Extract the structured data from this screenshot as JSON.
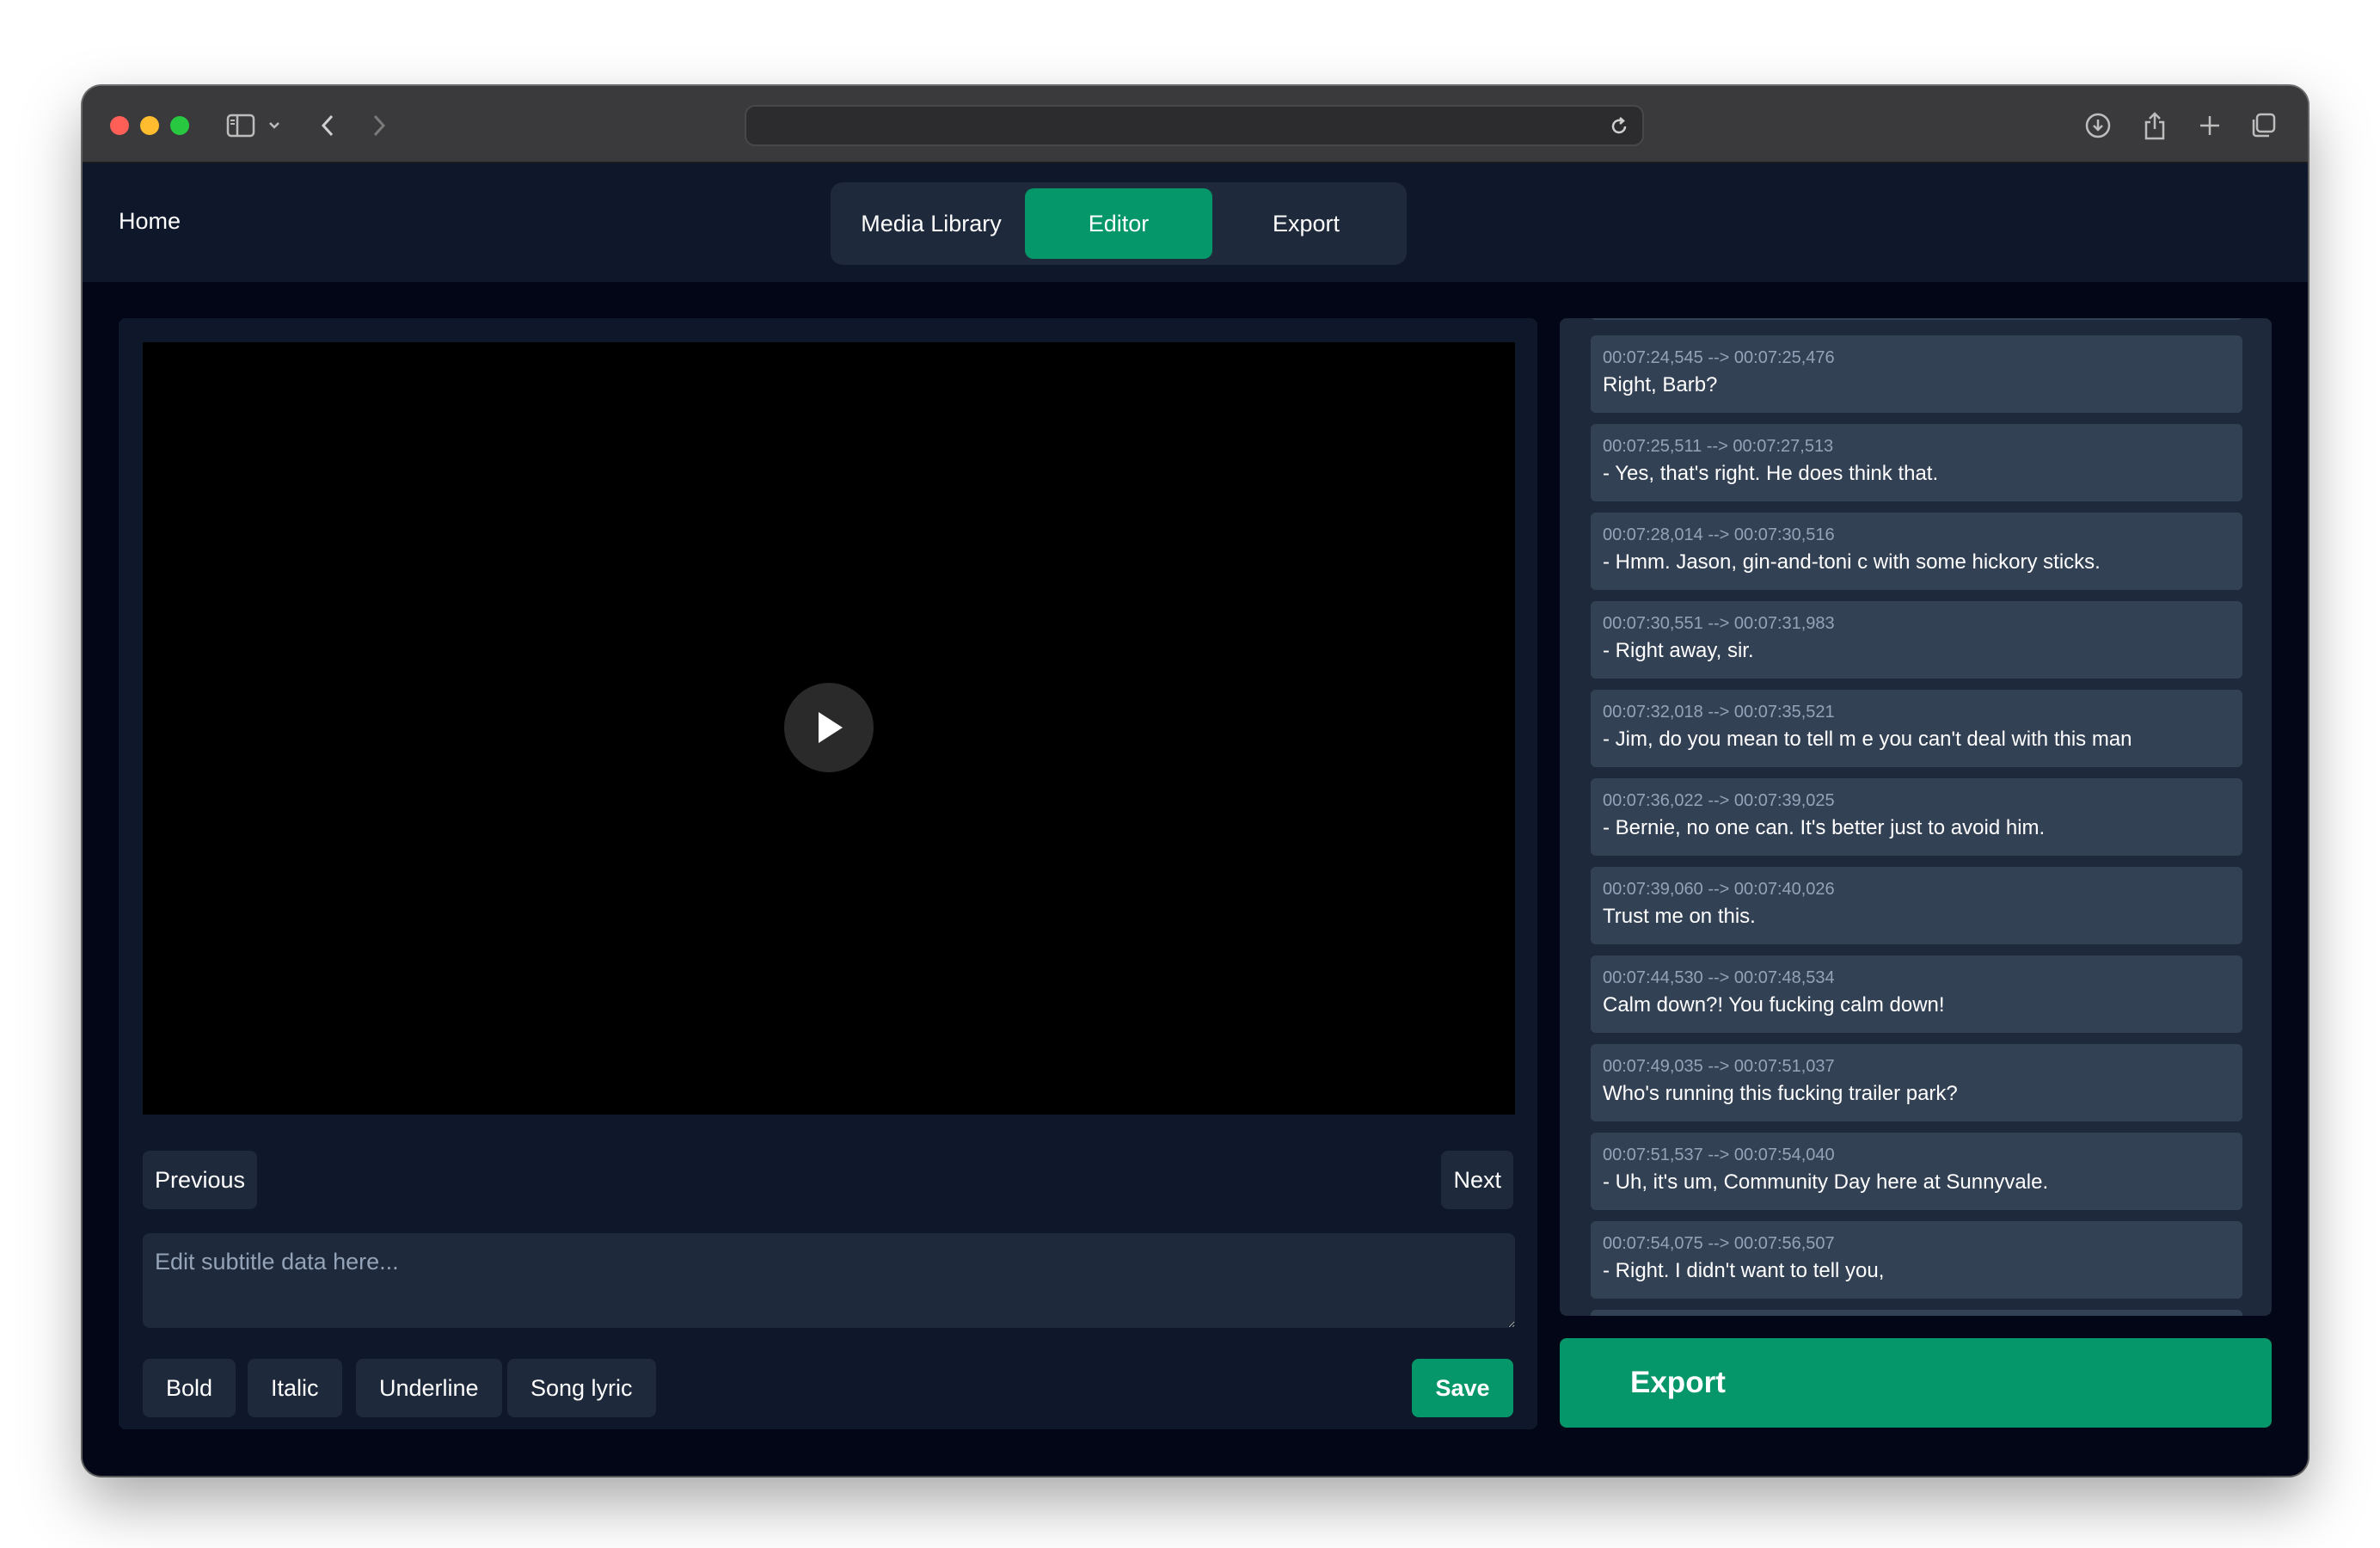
{
  "nav": {
    "home": "Home",
    "tabs": [
      {
        "label": "Media Library"
      },
      {
        "label": "Editor"
      },
      {
        "label": "Export"
      }
    ]
  },
  "player": {
    "previous": "Previous",
    "next": "Next"
  },
  "editor": {
    "placeholder": "Edit subtitle data here...",
    "format_buttons": [
      "Bold",
      "Italic",
      "Underline",
      "Song lyric"
    ],
    "save": "Save"
  },
  "subtitles": [
    {
      "time": "00:07:24,545 --> 00:07:25,476",
      "text": "Right, Barb?"
    },
    {
      "time": "00:07:25,511 --> 00:07:27,513",
      "text": "- Yes, that's right. He does think that."
    },
    {
      "time": "00:07:28,014 --> 00:07:30,516",
      "text": "- Hmm. Jason, gin-and-toni c with some hickory sticks."
    },
    {
      "time": "00:07:30,551 --> 00:07:31,983",
      "text": "- Right away, sir."
    },
    {
      "time": "00:07:32,018 --> 00:07:35,521",
      "text": "- Jim, do you mean to tell m e you can't deal with this man"
    },
    {
      "time": "00:07:36,022 --> 00:07:39,025",
      "text": "- Bernie, no one can. It's better just to avoid him."
    },
    {
      "time": "00:07:39,060 --> 00:07:40,026",
      "text": "Trust me on this."
    },
    {
      "time": "00:07:44,530 --> 00:07:48,534",
      "text": "Calm down?! You fucking calm down!"
    },
    {
      "time": "00:07:49,035 --> 00:07:51,037",
      "text": "Who's running this fucking trailer park?"
    },
    {
      "time": "00:07:51,537 --> 00:07:54,040",
      "text": "- Uh, it's um, Community Day here at Sunnyvale."
    },
    {
      "time": "00:07:54,075 --> 00:07:56,507",
      "text": "- Right. I didn't want to tell you,"
    }
  ],
  "export_button": "Export",
  "colors": {
    "accent": "#059669",
    "panel": "#1e293b",
    "card": "#334155",
    "background": "#020617"
  }
}
